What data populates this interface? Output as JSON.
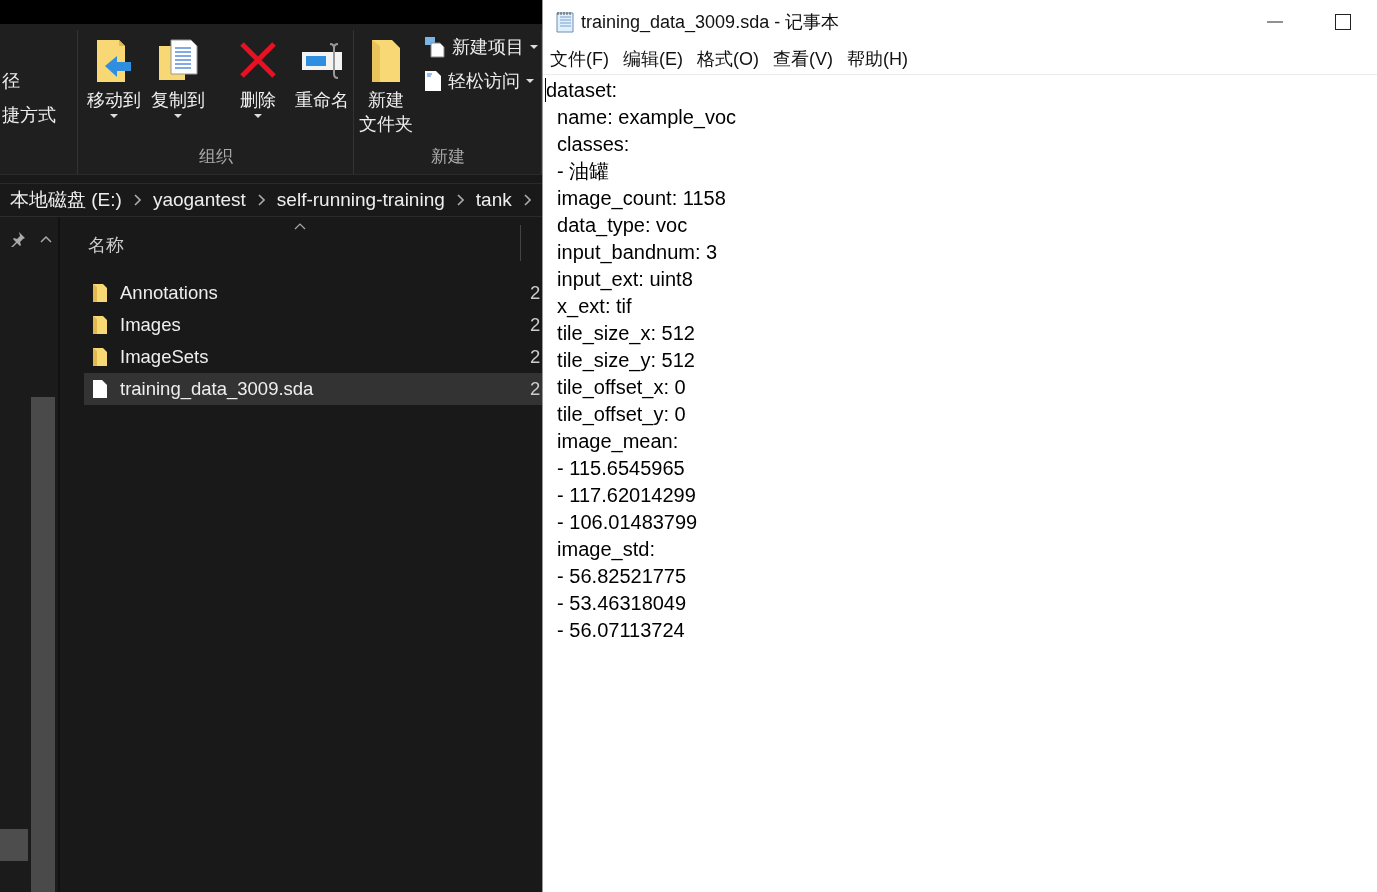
{
  "explorer": {
    "ribbon": {
      "groups": [
        {
          "items": [
            {
              "label": "径",
              "kind": "small",
              "dropdown": false
            },
            {
              "label": "捷方式",
              "kind": "small",
              "dropdown": false
            }
          ]
        },
        {
          "title": "组织",
          "items": [
            {
              "label": "移动到",
              "kind": "large",
              "dropdown": true
            },
            {
              "label": "复制到",
              "kind": "large",
              "dropdown": true
            },
            {
              "label": "删除",
              "kind": "large",
              "dropdown": true
            },
            {
              "label": "重命名",
              "kind": "large",
              "dropdown": false
            }
          ]
        },
        {
          "title": "新建",
          "items": [
            {
              "label_lines": [
                "新建",
                "文件夹"
              ],
              "kind": "large",
              "dropdown": false
            },
            {
              "label": "新建项目",
              "kind": "small",
              "dropdown": true
            },
            {
              "label": "轻松访问",
              "kind": "small",
              "dropdown": true
            }
          ]
        }
      ]
    },
    "breadcrumb": [
      "本地磁盘 (E:)",
      "yaogantest",
      "self-running-training",
      "tank"
    ],
    "file_list": {
      "columns": [
        {
          "label": "名称"
        }
      ],
      "rows": [
        {
          "name": "Annotations",
          "kind": "folder",
          "column_2": "2",
          "selected": false
        },
        {
          "name": "Images",
          "kind": "folder",
          "column_2": "2",
          "selected": false
        },
        {
          "name": "ImageSets",
          "kind": "folder",
          "column_2": "2",
          "selected": false
        },
        {
          "name": "training_data_3009.sda",
          "kind": "file",
          "column_2": "2",
          "selected": true
        }
      ]
    }
  },
  "notepad": {
    "title": "training_data_3009.sda - 记事本",
    "menu": [
      "文件(F)",
      "编辑(E)",
      "格式(O)",
      "查看(V)",
      "帮助(H)"
    ],
    "lines": [
      "dataset:",
      "  name: example_voc",
      "  classes:",
      "  - 油罐",
      "  image_count: 1158",
      "  data_type: voc",
      "  input_bandnum: 3",
      "  input_ext: uint8",
      "  x_ext: tif",
      "  tile_size_x: 512",
      "  tile_size_y: 512",
      "  tile_offset_x: 0",
      "  tile_offset_y: 0",
      "  image_mean:",
      "  - 115.6545965",
      "  - 117.62014299",
      "  - 106.01483799",
      "  image_std:",
      "  - 56.82521775",
      "  - 53.46318049",
      "  - 56.07113724"
    ]
  }
}
